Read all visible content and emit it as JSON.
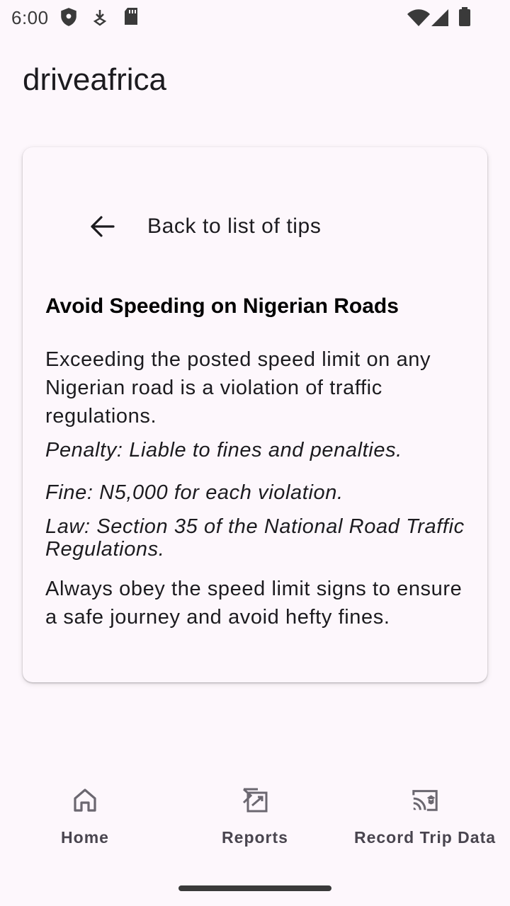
{
  "status_bar": {
    "time": "6:00",
    "left_icons": [
      "shield-icon",
      "download-icon",
      "sd-card-icon"
    ],
    "right_icons": [
      "wifi-icon",
      "signal-icon",
      "battery-icon"
    ]
  },
  "app": {
    "title": "driveafrica"
  },
  "tip": {
    "back_label": "Back to list of tips",
    "title": "Avoid Speeding on Nigerian Roads",
    "description": "Exceeding the posted speed limit on any Nigerian road is a violation of traffic regulations.",
    "penalty": "Penalty: Liable to fines and penalties.",
    "fine": "Fine: N5,000 for each violation.",
    "law": "Law: Section 35 of the National Road Traffic Regulations.",
    "advice": "Always obey the speed limit signs to ensure a safe journey and avoid hefty fines."
  },
  "bottom_nav": {
    "items": [
      {
        "label": "Home",
        "icon": "home-icon"
      },
      {
        "label": "Reports",
        "icon": "reports-icon"
      },
      {
        "label": "Record Trip Data",
        "icon": "cast-icon"
      }
    ]
  },
  "colors": {
    "background": "#fdf7fc",
    "text": "#1c1b1f",
    "nav_text": "#49454f"
  }
}
